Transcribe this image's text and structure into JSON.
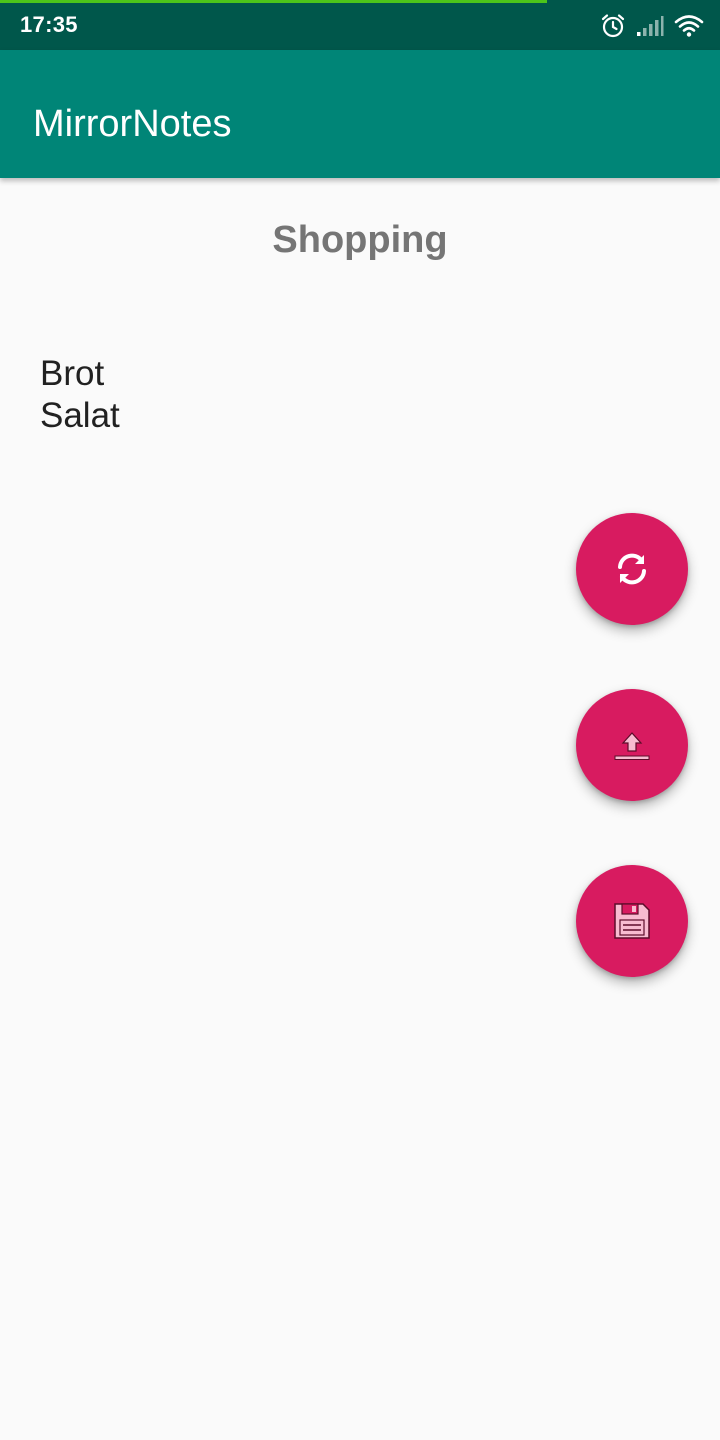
{
  "status_bar": {
    "time": "17:35",
    "page_load_progress": 0.76,
    "icons": [
      "alarm-icon",
      "cellular-signal-icon",
      "wifi-icon"
    ]
  },
  "app_bar": {
    "title": "MirrorNotes"
  },
  "note": {
    "title": "Shopping",
    "lines": [
      "Brot",
      "Salat"
    ]
  },
  "fabs": [
    {
      "name": "refresh-button",
      "icon": "refresh-icon"
    },
    {
      "name": "upload-button",
      "icon": "upload-icon"
    },
    {
      "name": "save-button",
      "icon": "floppy-disk-icon"
    }
  ],
  "colors": {
    "status_bar": "#00574b",
    "app_bar": "#008577",
    "accent": "#d81b60",
    "progress": "#4cc51a",
    "background": "#fafafa"
  }
}
